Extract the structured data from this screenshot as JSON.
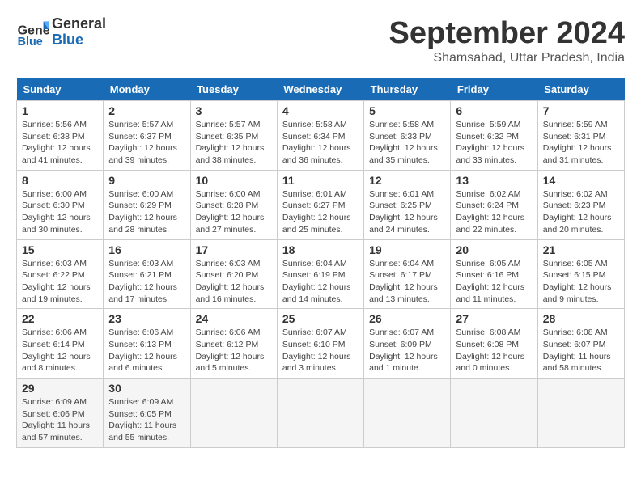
{
  "header": {
    "logo_line1": "General",
    "logo_line2": "Blue",
    "month_year": "September 2024",
    "location": "Shamsabad, Uttar Pradesh, India"
  },
  "days_of_week": [
    "Sunday",
    "Monday",
    "Tuesday",
    "Wednesday",
    "Thursday",
    "Friday",
    "Saturday"
  ],
  "weeks": [
    [
      {
        "day": "1",
        "sunrise": "Sunrise: 5:56 AM",
        "sunset": "Sunset: 6:38 PM",
        "daylight": "Daylight: 12 hours and 41 minutes."
      },
      {
        "day": "2",
        "sunrise": "Sunrise: 5:57 AM",
        "sunset": "Sunset: 6:37 PM",
        "daylight": "Daylight: 12 hours and 39 minutes."
      },
      {
        "day": "3",
        "sunrise": "Sunrise: 5:57 AM",
        "sunset": "Sunset: 6:35 PM",
        "daylight": "Daylight: 12 hours and 38 minutes."
      },
      {
        "day": "4",
        "sunrise": "Sunrise: 5:58 AM",
        "sunset": "Sunset: 6:34 PM",
        "daylight": "Daylight: 12 hours and 36 minutes."
      },
      {
        "day": "5",
        "sunrise": "Sunrise: 5:58 AM",
        "sunset": "Sunset: 6:33 PM",
        "daylight": "Daylight: 12 hours and 35 minutes."
      },
      {
        "day": "6",
        "sunrise": "Sunrise: 5:59 AM",
        "sunset": "Sunset: 6:32 PM",
        "daylight": "Daylight: 12 hours and 33 minutes."
      },
      {
        "day": "7",
        "sunrise": "Sunrise: 5:59 AM",
        "sunset": "Sunset: 6:31 PM",
        "daylight": "Daylight: 12 hours and 31 minutes."
      }
    ],
    [
      {
        "day": "8",
        "sunrise": "Sunrise: 6:00 AM",
        "sunset": "Sunset: 6:30 PM",
        "daylight": "Daylight: 12 hours and 30 minutes."
      },
      {
        "day": "9",
        "sunrise": "Sunrise: 6:00 AM",
        "sunset": "Sunset: 6:29 PM",
        "daylight": "Daylight: 12 hours and 28 minutes."
      },
      {
        "day": "10",
        "sunrise": "Sunrise: 6:00 AM",
        "sunset": "Sunset: 6:28 PM",
        "daylight": "Daylight: 12 hours and 27 minutes."
      },
      {
        "day": "11",
        "sunrise": "Sunrise: 6:01 AM",
        "sunset": "Sunset: 6:27 PM",
        "daylight": "Daylight: 12 hours and 25 minutes."
      },
      {
        "day": "12",
        "sunrise": "Sunrise: 6:01 AM",
        "sunset": "Sunset: 6:25 PM",
        "daylight": "Daylight: 12 hours and 24 minutes."
      },
      {
        "day": "13",
        "sunrise": "Sunrise: 6:02 AM",
        "sunset": "Sunset: 6:24 PM",
        "daylight": "Daylight: 12 hours and 22 minutes."
      },
      {
        "day": "14",
        "sunrise": "Sunrise: 6:02 AM",
        "sunset": "Sunset: 6:23 PM",
        "daylight": "Daylight: 12 hours and 20 minutes."
      }
    ],
    [
      {
        "day": "15",
        "sunrise": "Sunrise: 6:03 AM",
        "sunset": "Sunset: 6:22 PM",
        "daylight": "Daylight: 12 hours and 19 minutes."
      },
      {
        "day": "16",
        "sunrise": "Sunrise: 6:03 AM",
        "sunset": "Sunset: 6:21 PM",
        "daylight": "Daylight: 12 hours and 17 minutes."
      },
      {
        "day": "17",
        "sunrise": "Sunrise: 6:03 AM",
        "sunset": "Sunset: 6:20 PM",
        "daylight": "Daylight: 12 hours and 16 minutes."
      },
      {
        "day": "18",
        "sunrise": "Sunrise: 6:04 AM",
        "sunset": "Sunset: 6:19 PM",
        "daylight": "Daylight: 12 hours and 14 minutes."
      },
      {
        "day": "19",
        "sunrise": "Sunrise: 6:04 AM",
        "sunset": "Sunset: 6:17 PM",
        "daylight": "Daylight: 12 hours and 13 minutes."
      },
      {
        "day": "20",
        "sunrise": "Sunrise: 6:05 AM",
        "sunset": "Sunset: 6:16 PM",
        "daylight": "Daylight: 12 hours and 11 minutes."
      },
      {
        "day": "21",
        "sunrise": "Sunrise: 6:05 AM",
        "sunset": "Sunset: 6:15 PM",
        "daylight": "Daylight: 12 hours and 9 minutes."
      }
    ],
    [
      {
        "day": "22",
        "sunrise": "Sunrise: 6:06 AM",
        "sunset": "Sunset: 6:14 PM",
        "daylight": "Daylight: 12 hours and 8 minutes."
      },
      {
        "day": "23",
        "sunrise": "Sunrise: 6:06 AM",
        "sunset": "Sunset: 6:13 PM",
        "daylight": "Daylight: 12 hours and 6 minutes."
      },
      {
        "day": "24",
        "sunrise": "Sunrise: 6:06 AM",
        "sunset": "Sunset: 6:12 PM",
        "daylight": "Daylight: 12 hours and 5 minutes."
      },
      {
        "day": "25",
        "sunrise": "Sunrise: 6:07 AM",
        "sunset": "Sunset: 6:10 PM",
        "daylight": "Daylight: 12 hours and 3 minutes."
      },
      {
        "day": "26",
        "sunrise": "Sunrise: 6:07 AM",
        "sunset": "Sunset: 6:09 PM",
        "daylight": "Daylight: 12 hours and 1 minute."
      },
      {
        "day": "27",
        "sunrise": "Sunrise: 6:08 AM",
        "sunset": "Sunset: 6:08 PM",
        "daylight": "Daylight: 12 hours and 0 minutes."
      },
      {
        "day": "28",
        "sunrise": "Sunrise: 6:08 AM",
        "sunset": "Sunset: 6:07 PM",
        "daylight": "Daylight: 11 hours and 58 minutes."
      }
    ],
    [
      {
        "day": "29",
        "sunrise": "Sunrise: 6:09 AM",
        "sunset": "Sunset: 6:06 PM",
        "daylight": "Daylight: 11 hours and 57 minutes."
      },
      {
        "day": "30",
        "sunrise": "Sunrise: 6:09 AM",
        "sunset": "Sunset: 6:05 PM",
        "daylight": "Daylight: 11 hours and 55 minutes."
      },
      null,
      null,
      null,
      null,
      null
    ]
  ]
}
